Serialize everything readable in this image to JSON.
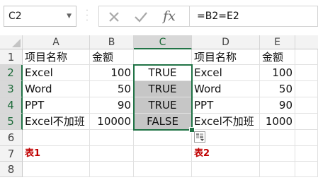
{
  "formula_bar": {
    "name_box": "C2",
    "formula": "=B2=E2",
    "icons": [
      "cancel-icon",
      "enter-icon",
      "insert-function-icon"
    ],
    "fx_label": "fx"
  },
  "columns": [
    "A",
    "B",
    "C",
    "D",
    "E"
  ],
  "rows": [
    "1",
    "2",
    "3",
    "4",
    "5",
    "6",
    "7",
    "8"
  ],
  "cells": {
    "A1": "项目名称",
    "B1": "金额",
    "C1": "",
    "D1": "项目名称",
    "E1": "金额",
    "A2": "Excel",
    "B2": "100",
    "C2": "TRUE",
    "D2": "Excel",
    "E2": "100",
    "A3": "Word",
    "B3": "50",
    "C3": "TRUE",
    "D3": "Word",
    "E3": "50",
    "A4": "PPT",
    "B4": "90",
    "C4": "TRUE",
    "D4": "PPT",
    "E4": "90",
    "A5": "Excel不加班",
    "B5": "10000",
    "C5": "FALSE",
    "D5": "Excel不加班",
    "E5": "1000",
    "A7": "表1",
    "D7": "表2"
  },
  "colors": {
    "selection_green": "#217346",
    "label_red": "#c00000"
  }
}
